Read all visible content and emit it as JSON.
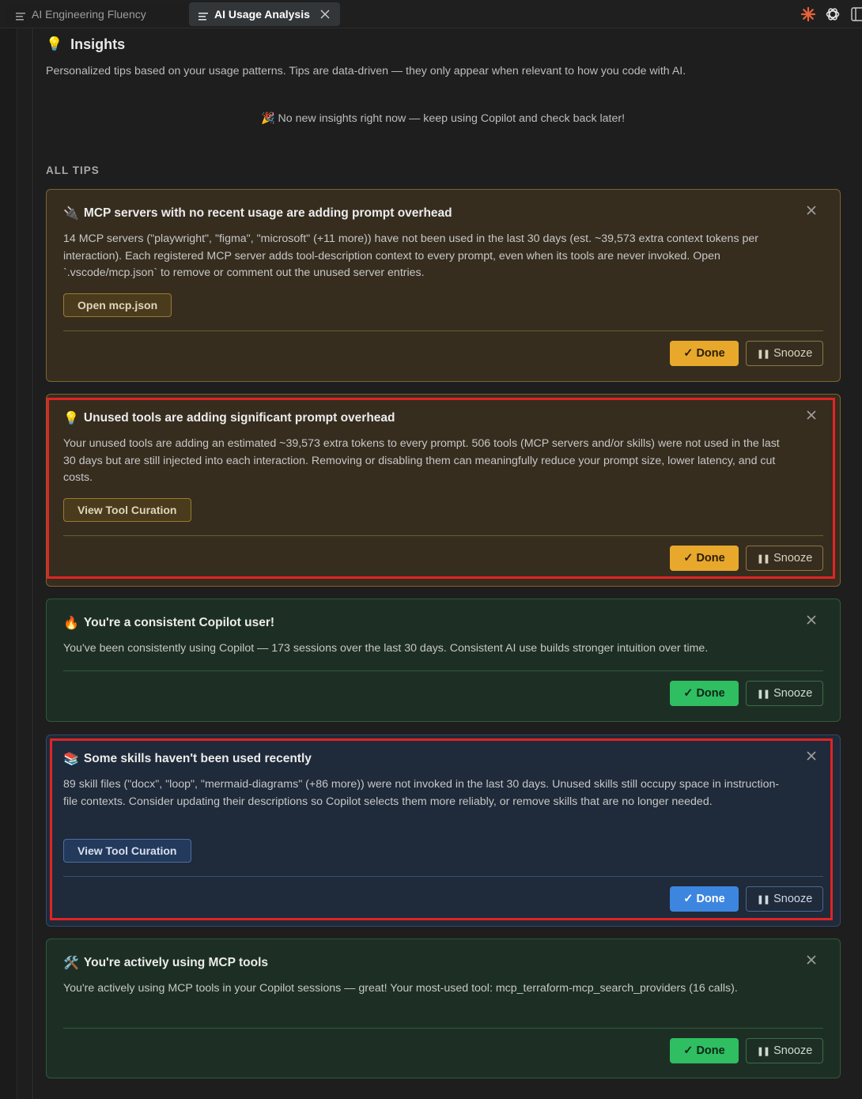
{
  "tabs": [
    {
      "label": "AI Engineering Fluency",
      "active": false
    },
    {
      "label": "AI Usage Analysis",
      "active": true
    }
  ],
  "top_icons": [
    "claude-sparkle-icon",
    "openai-icon",
    "split-editor-icon"
  ],
  "insights": {
    "title": "Insights",
    "subtitle": "Personalized tips based on your usage patterns. Tips are data-driven — they only appear when relevant to how you code with AI.",
    "empty_message": "🎉 No new insights right now — keep using Copilot and check back later!"
  },
  "all_tips_label": "ALL TIPS",
  "tips": [
    {
      "emoji": "🔌",
      "title": "MCP servers with no recent usage are adding prompt overhead",
      "body": "14 MCP servers (\"playwright\", \"figma\", \"microsoft\" (+11 more)) have not been used in the last 30 days (est. ~39,573 extra context tokens per interaction). Each registered MCP server adds tool-description context to every prompt, even when its tools are never invoked. Open `.vscode/mcp.json` to remove or comment out the unused server entries.",
      "action": "Open mcp.json",
      "done": "✓ Done",
      "snooze": "Snooze",
      "theme": "amber"
    },
    {
      "emoji": "💡",
      "title": "Unused tools are adding significant prompt overhead",
      "body": "Your unused tools are adding an estimated ~39,573 extra tokens to every prompt. 506 tools (MCP servers and/or skills) were not used in the last 30 days but are still injected into each interaction. Removing or disabling them can meaningfully reduce your prompt size, lower latency, and cut costs.",
      "action": "View Tool Curation",
      "done": "✓ Done",
      "snooze": "Snooze",
      "theme": "amber"
    },
    {
      "emoji": "🔥",
      "title": "You're a consistent Copilot user!",
      "body": "You've been consistently using Copilot — 173 sessions over the last 30 days. Consistent AI use builds stronger intuition over time.",
      "done": "✓ Done",
      "snooze": "Snooze",
      "theme": "green"
    },
    {
      "emoji": "📚",
      "title": "Some skills haven't been used recently",
      "body": "89 skill files (\"docx\", \"loop\", \"mermaid-diagrams\" (+86 more)) were not invoked in the last 30 days. Unused skills still occupy space in instruction-file contexts. Consider updating their descriptions so Copilot selects them more reliably, or remove skills that are no longer needed.",
      "action": "View Tool Curation",
      "done": "✓ Done",
      "snooze": "Snooze",
      "theme": "blue"
    },
    {
      "emoji": "🛠️",
      "title": "You're actively using MCP tools",
      "body": "You're actively using MCP tools in your Copilot sessions — great! Your most-used tool: mcp_terraform-mcp_search_providers (16 calls).",
      "done": "✓ Done",
      "snooze": "Snooze",
      "theme": "green"
    }
  ],
  "colors": {
    "amber_accent": "#e8a82c",
    "green_accent": "#2fbe61",
    "blue_accent": "#3d86e0",
    "highlight": "#e02424"
  }
}
